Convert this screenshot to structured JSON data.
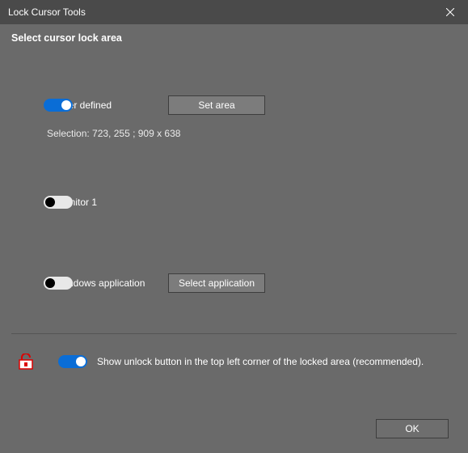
{
  "window": {
    "title": "Lock Cursor Tools"
  },
  "header": {
    "subtitle": "Select cursor lock area"
  },
  "options": {
    "user_defined": {
      "label": "User defined",
      "button": "Set area",
      "selection": "Selection: 723, 255 ;  909 x 638",
      "enabled": true
    },
    "monitor": {
      "label": "Monitor 1",
      "enabled": false
    },
    "windows_app": {
      "label": "Windows application",
      "button": "Select application",
      "enabled": false
    }
  },
  "unlock_option": {
    "label": "Show unlock button in the top left corner of the locked area (recommended).",
    "enabled": true
  },
  "footer": {
    "ok": "OK"
  }
}
